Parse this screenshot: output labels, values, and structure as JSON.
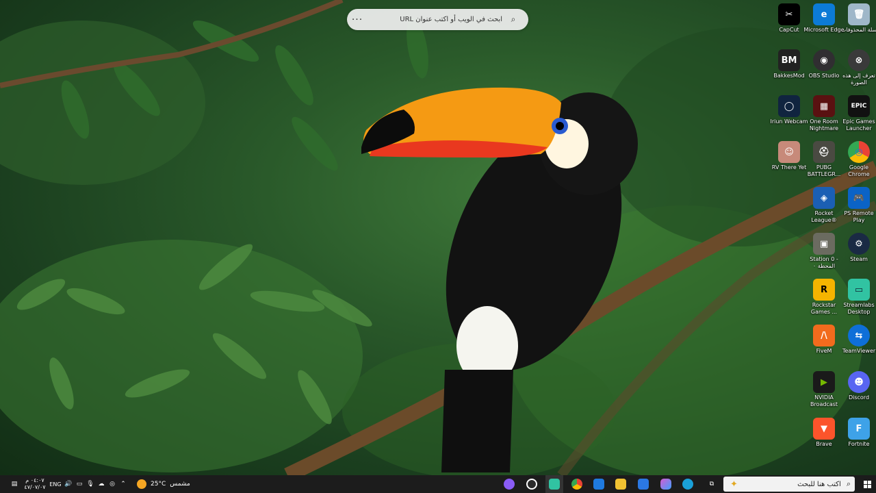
{
  "search_widget": {
    "placeholder": "ابحث في الويب أو اكتب عنوان URL",
    "more": "···",
    "icon": "search-icon"
  },
  "desktop": {
    "icons": [
      {
        "label": "CapCut",
        "color": "#000000",
        "glyph": "✂"
      },
      {
        "label": "Microsoft Edge",
        "color": "#0c7bd6",
        "glyph": "e"
      },
      {
        "label": "سلة المحذوفات",
        "color": "#9fb7c9",
        "glyph": "🗑"
      },
      {
        "label": "BakkesMod",
        "color": "#222222",
        "glyph": "BM"
      },
      {
        "label": "OBS Studio",
        "color": "#302e31",
        "glyph": "◉"
      },
      {
        "label": "تعرف إلى هذه الصورة",
        "color": "#3a3a3a",
        "glyph": "⊗"
      },
      {
        "label": "Iriun Webcam",
        "color": "#10243f",
        "glyph": "◯"
      },
      {
        "label": "One Room Nightmare",
        "color": "#5a1111",
        "glyph": "▦"
      },
      {
        "label": "Epic Games Launcher",
        "color": "#111111",
        "glyph": "EPIC"
      },
      {
        "label": "RV There Yet",
        "color": "#c78a7a",
        "glyph": "☺"
      },
      {
        "label": "PUBG BATTLEGR...",
        "color": "#4a4a42",
        "glyph": "⛑"
      },
      {
        "label": "Google Chrome",
        "color": "#ffffff",
        "glyph": "◎"
      },
      {
        "label": "Rocket League®",
        "color": "#1b5fb4",
        "glyph": "◈"
      },
      {
        "label": "PS Remote Play",
        "color": "#0b63c6",
        "glyph": "🎮"
      },
      {
        "label": "Station 0 - المحطة ٠",
        "color": "#6b6b60",
        "glyph": "▣"
      },
      {
        "label": "Steam",
        "color": "#1a2a44",
        "glyph": "⚙"
      },
      {
        "label": "Rockstar Games ...",
        "color": "#f5b400",
        "glyph": "R"
      },
      {
        "label": "Streamlabs Desktop",
        "color": "#31c3a2",
        "glyph": "▭"
      },
      {
        "label": "FiveM",
        "color": "#f26b1d",
        "glyph": "/\\"
      },
      {
        "label": "TeamViewer",
        "color": "#0e6fd8",
        "glyph": "⇆"
      },
      {
        "label": "NVIDIA Broadcast",
        "color": "#1a1a1a",
        "glyph": "▶"
      },
      {
        "label": "Discord",
        "color": "#5865f2",
        "glyph": "☻"
      },
      {
        "label": "Brave",
        "color": "#fb542b",
        "glyph": "▼"
      },
      {
        "label": "Fortnite",
        "color": "#3ea2e8",
        "glyph": "F"
      }
    ]
  },
  "taskbar": {
    "start_icon": "windows-icon",
    "search_placeholder": "اكتب هنا للبحث",
    "weather_temp": "25°C",
    "weather_desc": "مشمس",
    "time": "٠٤:٠٧ م",
    "date": "٤٧/٠٧/٠٧",
    "language": "ENG",
    "apps": [
      {
        "name": "copilot",
        "color": "#8a5cf6"
      },
      {
        "name": "obs",
        "color": "#2b2b2b"
      },
      {
        "name": "streamlabs",
        "color": "#31c3a2"
      },
      {
        "name": "chrome",
        "color": "#e8c11a"
      },
      {
        "name": "store",
        "color": "#1f7ae0"
      },
      {
        "name": "file-explorer",
        "color": "#f1c232"
      },
      {
        "name": "mail",
        "color": "#2b78e4"
      },
      {
        "name": "copilot-app",
        "color": "#d65cd1"
      },
      {
        "name": "edge",
        "color": "#1aa0d8"
      },
      {
        "name": "task-view",
        "color": "#444444"
      }
    ]
  }
}
